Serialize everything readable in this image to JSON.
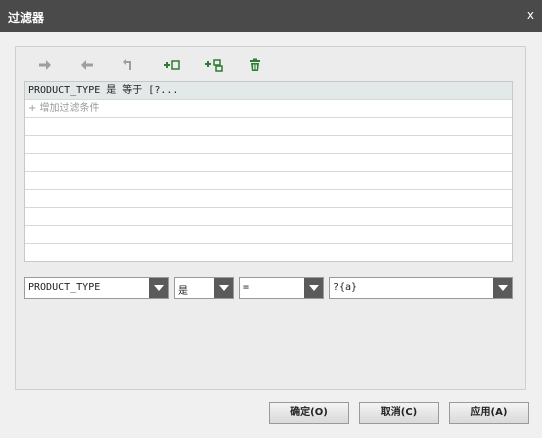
{
  "window": {
    "title": "过滤器",
    "close_label": "x"
  },
  "toolbar": {
    "icons": [
      "arrow-right-icon",
      "arrow-left-icon",
      "return-arrow-icon",
      "add-condition-icon",
      "add-sub-condition-icon",
      "trash-icon"
    ],
    "active_color": "#2e7d32",
    "disabled_color": "#9e9e9e"
  },
  "conditions": {
    "rows": [
      {
        "text": "PRODUCT_TYPE 是 等于 [?...",
        "selected": true
      },
      {
        "text": "+ 增加过滤条件",
        "placeholder": true
      },
      {
        "text": ""
      },
      {
        "text": ""
      },
      {
        "text": ""
      },
      {
        "text": ""
      },
      {
        "text": ""
      },
      {
        "text": ""
      },
      {
        "text": ""
      }
    ]
  },
  "editor": {
    "field": "PRODUCT_TYPE",
    "negation": "是",
    "operator": "=",
    "value": "?{a}"
  },
  "buttons": {
    "ok": "确定(O)",
    "cancel": "取消(C)",
    "apply": "应用(A)"
  }
}
